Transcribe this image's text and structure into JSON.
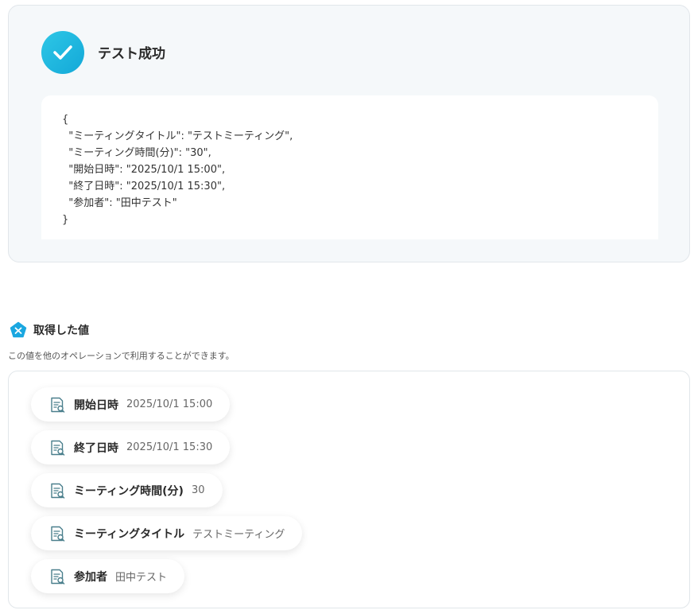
{
  "result": {
    "title": "テスト成功",
    "json_lines": [
      "{",
      "  \"ミーティングタイトル\": \"テストミーティング\",",
      "  \"ミーティング時間(分)\": \"30\",",
      "  \"開始日時\": \"2025/10/1 15:00\",",
      "  \"終了日時\": \"2025/10/1 15:30\",",
      "  \"参加者\": \"田中テスト\"",
      "}"
    ]
  },
  "section": {
    "title": "取得した値",
    "description": "この値を他のオペレーションで利用することができます。"
  },
  "values": [
    {
      "label": "開始日時",
      "value": "2025/10/1 15:00"
    },
    {
      "label": "終了日時",
      "value": "2025/10/1 15:30"
    },
    {
      "label": "ミーティング時間(分)",
      "value": "30"
    },
    {
      "label": "ミーティングタイトル",
      "value": "テストミーティング"
    },
    {
      "label": "参加者",
      "value": "田中テスト"
    }
  ],
  "colors": {
    "accent": "#1bb3de",
    "card_bg": "#f5f8fa",
    "icon_stroke": "#4a7f8c"
  },
  "icons": {
    "success": "check-circle-icon",
    "section": "variable-pentagon-icon",
    "chip": "document-search-icon"
  }
}
